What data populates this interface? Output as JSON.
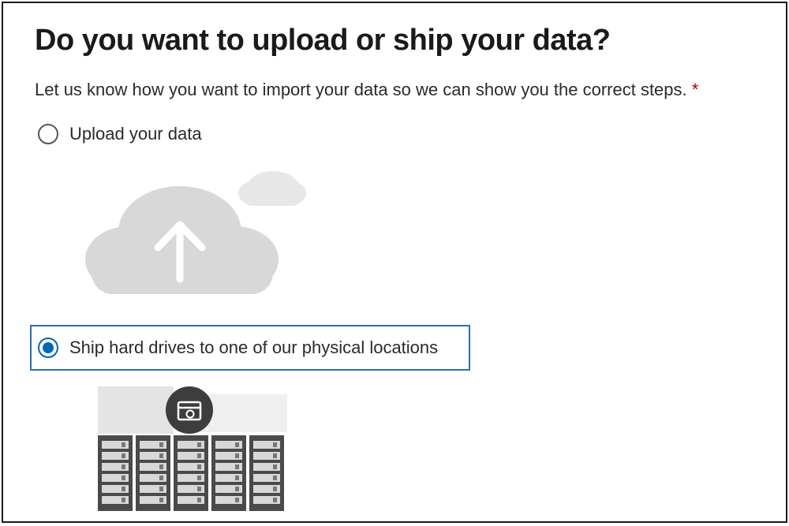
{
  "heading": "Do you want to upload or ship your data?",
  "subheading": "Let us know how you want to import your data so we can show you the correct steps. ",
  "required_mark": "*",
  "options": {
    "upload": {
      "label": "Upload your data",
      "selected": false
    },
    "ship": {
      "label": "Ship hard drives to one of our physical locations",
      "selected": true
    }
  },
  "icons": {
    "cloud_upload": "cloud-upload-icon",
    "server_rack": "server-rack-icon"
  },
  "colors": {
    "accent": "#0067b8",
    "border_highlight": "#2a6fb5",
    "required": "#a80000"
  }
}
